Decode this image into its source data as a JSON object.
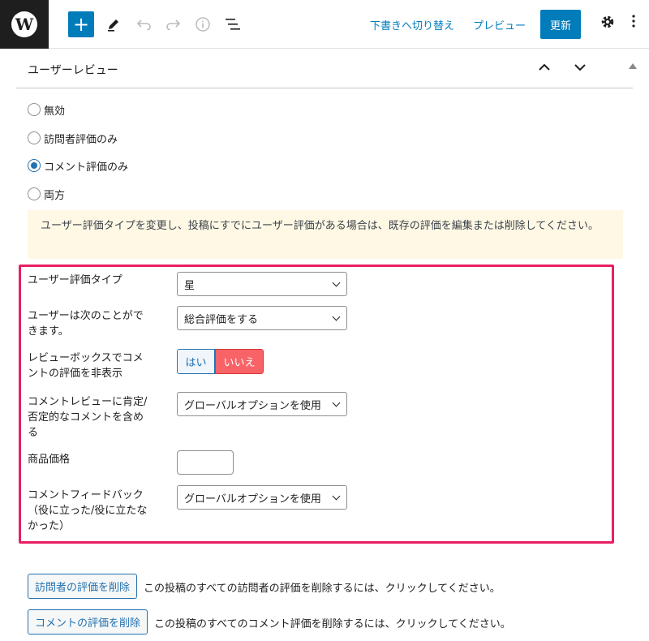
{
  "toolbar": {
    "logo_letter": "W",
    "add_icon": "+",
    "switch_to_draft": "下書きへ切り替え",
    "preview": "プレビュー",
    "update": "更新",
    "icons": [
      "wordpress-logo",
      "plus-icon",
      "pencil-icon",
      "undo-icon",
      "redo-icon",
      "info-icon",
      "list-view-icon",
      "gear-icon",
      "more-vertical-icon"
    ]
  },
  "panel": {
    "title": "ユーザーレビュー"
  },
  "review_mode": {
    "options": [
      "無効",
      "訪問者評価のみ",
      "コメント評価のみ",
      "両方"
    ],
    "selected": "コメント評価のみ"
  },
  "notice": "ユーザー評価タイプを変更し、投稿にすでにユーザー評価がある場合は、既存の評価を編集または削除してください。",
  "fields": {
    "rating_type_label": "ユーザー評価タイプ",
    "rating_type_value": "星",
    "user_can_label": "ユーザーは次のことができます。",
    "user_can_value": "総合評価をする",
    "hide_label": "レビューボックスでコメントの評価を非表示",
    "hide_yes": "はい",
    "hide_no": "いいえ",
    "hide_selected": "いいえ",
    "pros_cons_label": "コメントレビューに肯定/否定的なコメントを含める",
    "pros_cons_value": "グローバルオプションを使用",
    "price_label": "商品価格",
    "price_value": "",
    "feedback_label": "コメントフィードバック（役に立った/役に立たなかった）",
    "feedback_value": "グローバルオプションを使用"
  },
  "actions": {
    "delete_visitor_label": "訪問者の評価を削除",
    "delete_visitor_desc": "この投稿のすべての訪問者の評価を削除するには、クリックしてください。",
    "delete_comment_label": "コメントの評価を削除",
    "delete_comment_desc": "この投稿のすべてのコメント評価を削除するには、クリックしてください。"
  },
  "colors": {
    "accent": "#007cba",
    "highlight_border": "#e91e63",
    "notice_bg": "#fff8e5",
    "no_button": "#f86368"
  }
}
